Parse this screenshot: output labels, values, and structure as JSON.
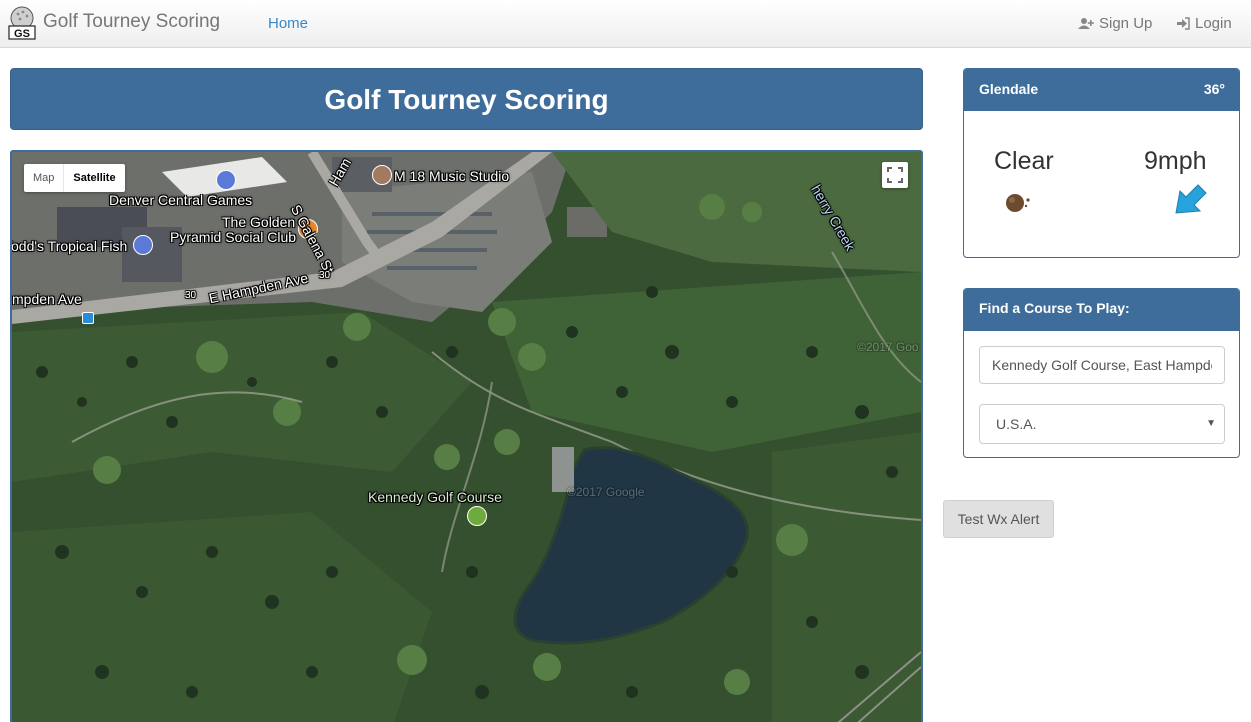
{
  "navbar": {
    "brand_logo_text": "GS",
    "brand": "Golf Tourney Scoring",
    "home": "Home",
    "signup": "Sign Up",
    "login": "Login"
  },
  "banner": {
    "title": "Golf Tourney Scoring"
  },
  "map": {
    "type_buttons": {
      "map": "Map",
      "satellite": "Satellite",
      "active": "Satellite"
    },
    "labels": {
      "music_studio": "M 18 Music Studio",
      "denver_central_games": "Denver Central Games",
      "golden_pyramid_1": "The Golden",
      "golden_pyramid_2": "Pyramid Social Club",
      "tropical_fish": "Todd's Tropical Fish",
      "hampden_ave": "E Hampden Ave",
      "hampden_ave_left": "mpden Ave",
      "galena": "S Galena St",
      "hampden_street_top": "Ham",
      "cherry_creek": "herry Creek",
      "kennedy": "Kennedy Golf Course",
      "route_30": "30"
    },
    "watermarks": [
      "©2017 Goo",
      "©2017 Google"
    ]
  },
  "weather": {
    "city": "Glendale",
    "temp": "36°",
    "condition": "Clear",
    "wind": "9mph",
    "condition_icon": "moon-clear-icon",
    "wind_icon": "wind-direction-arrow-icon"
  },
  "find_course": {
    "heading": "Find a Course To Play:",
    "course_value": "Kennedy Golf Course, East Hampden",
    "country": "U.S.A."
  },
  "buttons": {
    "test_wx_alert": "Test Wx Alert"
  },
  "colors": {
    "primary": "#3e6d9b",
    "link": "#3a87c8",
    "wind_arrow": "#27a3dc"
  }
}
